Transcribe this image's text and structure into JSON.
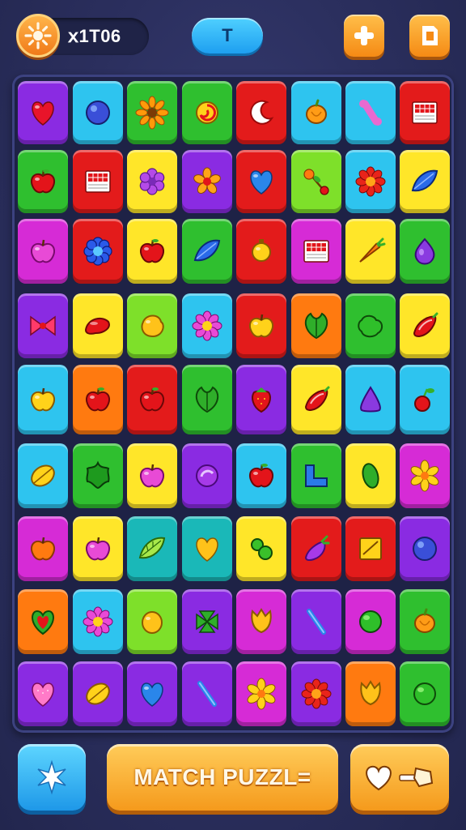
{
  "header": {
    "score": "ⅹ1T06",
    "center_pill": "T",
    "sun_icon": "sun-icon",
    "plus_icon": "plus-icon",
    "page_icon": "page-icon"
  },
  "board": {
    "rows": 9,
    "cols": 8,
    "tiles": [
      [
        {
          "bg": "#8a2be2",
          "icon": "heart"
        },
        {
          "bg": "#2ec4ef",
          "icon": "blue-orb"
        },
        {
          "bg": "#2fbf2f",
          "icon": "sunflower"
        },
        {
          "bg": "#2fbf2f",
          "icon": "swirl"
        },
        {
          "bg": "#e31b1b",
          "icon": "crescent"
        },
        {
          "bg": "#2ec4ef",
          "icon": "orange-fruit"
        },
        {
          "bg": "#2ec4ef",
          "icon": "pink-bone"
        },
        {
          "bg": "#e31b1b",
          "icon": "grid-card"
        }
      ],
      [
        {
          "bg": "#2fbf2f",
          "icon": "apple"
        },
        {
          "bg": "#e31b1b",
          "icon": "grid-card"
        },
        {
          "bg": "#ffe629",
          "icon": "purple-flower"
        },
        {
          "bg": "#8a2be2",
          "icon": "orange-flower"
        },
        {
          "bg": "#e31b1b",
          "icon": "blue-heart"
        },
        {
          "bg": "#7ee02a",
          "icon": "cherry-branch"
        },
        {
          "bg": "#2ec4ef",
          "icon": "red-flower"
        },
        {
          "bg": "#ffe629",
          "icon": "blue-leaf"
        }
      ],
      [
        {
          "bg": "#d62bd6",
          "icon": "pink-apple"
        },
        {
          "bg": "#e31b1b",
          "icon": "blue-flower"
        },
        {
          "bg": "#ffe629",
          "icon": "apple"
        },
        {
          "bg": "#2fbf2f",
          "icon": "blue-leaf"
        },
        {
          "bg": "#e31b1b",
          "icon": "yellow-bulb"
        },
        {
          "bg": "#d62bd6",
          "icon": "grid-card"
        },
        {
          "bg": "#ffe629",
          "icon": "carrot"
        },
        {
          "bg": "#2fbf2f",
          "icon": "purple-drop"
        }
      ],
      [
        {
          "bg": "#8a2be2",
          "icon": "bow"
        },
        {
          "bg": "#ffe629",
          "icon": "red-bean"
        },
        {
          "bg": "#7ee02a",
          "icon": "yellow-blob"
        },
        {
          "bg": "#2ec4ef",
          "icon": "pink-flower"
        },
        {
          "bg": "#e31b1b",
          "icon": "yellow-apple"
        },
        {
          "bg": "#ff7a10",
          "icon": "green-leaf"
        },
        {
          "bg": "#2fbf2f",
          "icon": "green-blob"
        },
        {
          "bg": "#ffe629",
          "icon": "red-pepper"
        }
      ],
      [
        {
          "bg": "#2ec4ef",
          "icon": "yellow-apple"
        },
        {
          "bg": "#ff7a10",
          "icon": "apple"
        },
        {
          "bg": "#e31b1b",
          "icon": "apple"
        },
        {
          "bg": "#2fbf2f",
          "icon": "green-leaf"
        },
        {
          "bg": "#8a2be2",
          "icon": "strawberry"
        },
        {
          "bg": "#ffe629",
          "icon": "red-pepper"
        },
        {
          "bg": "#2ec4ef",
          "icon": "purple-triangle"
        },
        {
          "bg": "#2ec4ef",
          "icon": "cherry"
        }
      ],
      [
        {
          "bg": "#2ec4ef",
          "icon": "yellow-leaf"
        },
        {
          "bg": "#2fbf2f",
          "icon": "green-star"
        },
        {
          "bg": "#ffe629",
          "icon": "pink-apple"
        },
        {
          "bg": "#8a2be2",
          "icon": "purple-orb"
        },
        {
          "bg": "#2ec4ef",
          "icon": "apple"
        },
        {
          "bg": "#2fbf2f",
          "icon": "blue-block"
        },
        {
          "bg": "#ffe629",
          "icon": "green-pea"
        },
        {
          "bg": "#d62bd6",
          "icon": "yellow-flower"
        }
      ],
      [
        {
          "bg": "#d62bd6",
          "icon": "orange-apple"
        },
        {
          "bg": "#ffe629",
          "icon": "pink-apple"
        },
        {
          "bg": "#1ab8b8",
          "icon": "leaf-light"
        },
        {
          "bg": "#1ab8b8",
          "icon": "yellow-heart"
        },
        {
          "bg": "#ffe629",
          "icon": "green-peas"
        },
        {
          "bg": "#e31b1b",
          "icon": "eggplant"
        },
        {
          "bg": "#e31b1b",
          "icon": "yellow-card"
        },
        {
          "bg": "#8a2be2",
          "icon": "blue-orb"
        }
      ],
      [
        {
          "bg": "#ff7a10",
          "icon": "green-heart"
        },
        {
          "bg": "#2ec4ef",
          "icon": "pink-flower"
        },
        {
          "bg": "#7ee02a",
          "icon": "yellow-orb"
        },
        {
          "bg": "#8a2be2",
          "icon": "green-clover"
        },
        {
          "bg": "#d62bd6",
          "icon": "yellow-tulip"
        },
        {
          "bg": "#8a2be2",
          "icon": "blue-stick"
        },
        {
          "bg": "#d62bd6",
          "icon": "green-orb"
        },
        {
          "bg": "#2fbf2f",
          "icon": "orange-fruit"
        }
      ],
      [
        {
          "bg": "#8a2be2",
          "icon": "pink-heart"
        },
        {
          "bg": "#8a2be2",
          "icon": "yellow-leaf"
        },
        {
          "bg": "#8a2be2",
          "icon": "blue-heart"
        },
        {
          "bg": "#8a2be2",
          "icon": "blue-stick"
        },
        {
          "bg": "#d62bd6",
          "icon": "yellow-flower"
        },
        {
          "bg": "#8a2be2",
          "icon": "red-flower"
        },
        {
          "bg": "#ff7a10",
          "icon": "yellow-tulip"
        },
        {
          "bg": "#2fbf2f",
          "icon": "green-orb"
        }
      ]
    ]
  },
  "footer": {
    "star_icon": "sparkle-icon",
    "match_label": "MATCH PUZZL=",
    "heart_key_icon": "heart-key-icon"
  },
  "colors": {
    "background": "#2b2f5e",
    "accent_orange": "#f59a1c",
    "accent_blue": "#1e9ff0"
  }
}
